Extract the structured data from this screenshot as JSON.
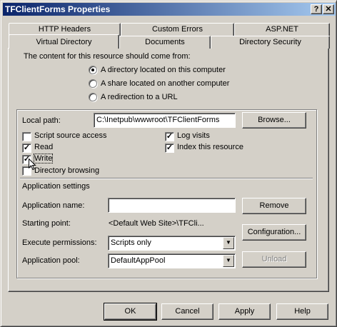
{
  "window": {
    "title": "TFClientForms Properties",
    "help_button": "?",
    "close_button": "✕"
  },
  "tabs": {
    "row1": [
      "HTTP Headers",
      "Custom Errors",
      "ASP.NET"
    ],
    "row2": [
      "Virtual Directory",
      "Documents",
      "Directory Security"
    ]
  },
  "content_source": {
    "label": "The content for this resource should come from:",
    "options": [
      {
        "label": "A directory located on this computer",
        "selected": true
      },
      {
        "label": "A share located on another computer",
        "selected": false
      },
      {
        "label": "A redirection to a URL",
        "selected": false
      }
    ]
  },
  "local_path": {
    "label": "Local path:",
    "value": "C:\\Inetpub\\wwwroot\\TFClientForms",
    "browse_label": "Browse..."
  },
  "permissions": [
    {
      "label": "Script source access",
      "checked": false
    },
    {
      "label": "Read",
      "checked": true
    },
    {
      "label": "Write",
      "checked": true
    },
    {
      "label": "Directory browsing",
      "checked": false
    },
    {
      "label": "Log visits",
      "checked": true
    },
    {
      "label": "Index this resource",
      "checked": true
    }
  ],
  "app_settings": {
    "heading": "Application settings",
    "name_label": "Application name:",
    "name_value": "",
    "remove_label": "Remove",
    "starting_point_label": "Starting point:",
    "starting_point_value": "<Default Web Site>\\TFCli...",
    "configuration_label": "Configuration...",
    "execute_label": "Execute permissions:",
    "execute_value": "Scripts only",
    "pool_label": "Application pool:",
    "pool_value": "DefaultAppPool",
    "unload_label": "Unload"
  },
  "footer": {
    "ok": "OK",
    "cancel": "Cancel",
    "apply": "Apply",
    "help": "Help"
  }
}
